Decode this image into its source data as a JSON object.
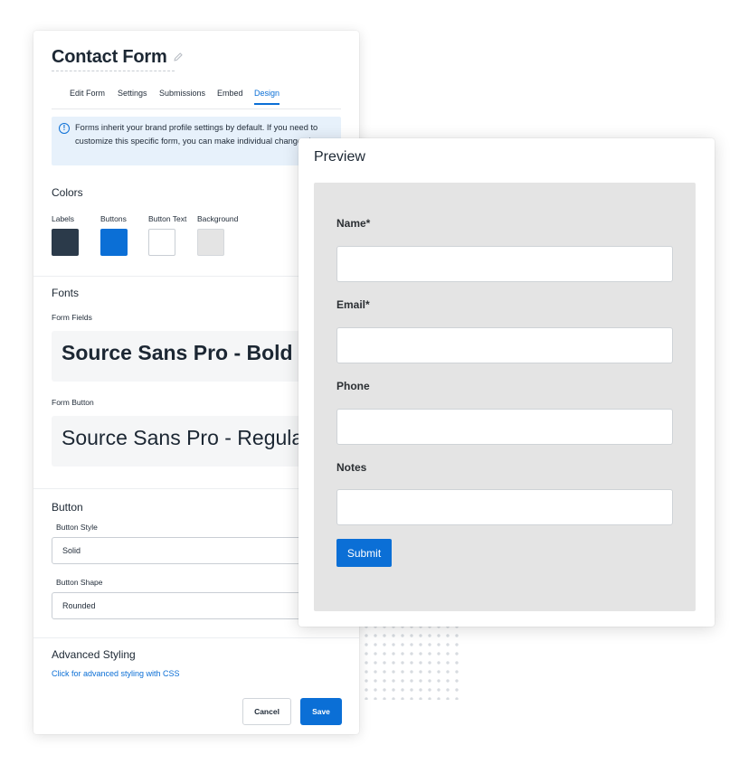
{
  "form": {
    "title": "Contact Form",
    "tabs": [
      {
        "label": "Edit Form",
        "active": false
      },
      {
        "label": "Settings",
        "active": false
      },
      {
        "label": "Submissions",
        "active": false
      },
      {
        "label": "Embed",
        "active": false
      },
      {
        "label": "Design",
        "active": true
      }
    ],
    "info_text": "Forms inherit your brand profile settings by default. If you need to customize this specific form, you can make individual changes here."
  },
  "colors": {
    "title": "Colors",
    "swatches": [
      {
        "label": "Labels",
        "color": "#2b3a4a"
      },
      {
        "label": "Buttons",
        "color": "#0b6fd6"
      },
      {
        "label": "Button Text",
        "color": "#ffffff"
      },
      {
        "label": "Background",
        "color": "#e4e4e4"
      }
    ]
  },
  "fonts": {
    "title": "Fonts",
    "form_fields_label": "Form Fields",
    "form_fields_value": "Source Sans Pro - Bold",
    "form_button_label": "Form Button",
    "form_button_value": "Source Sans Pro - Regular"
  },
  "button": {
    "title": "Button",
    "style_label": "Button Style",
    "style_value": "Solid",
    "shape_label": "Button Shape",
    "shape_value": "Rounded"
  },
  "advanced": {
    "title": "Advanced Styling",
    "link": "Click for advanced styling with CSS"
  },
  "actions": {
    "cancel": "Cancel",
    "save": "Save"
  },
  "preview": {
    "title": "Preview",
    "fields": [
      {
        "label": "Name*"
      },
      {
        "label": "Email*"
      },
      {
        "label": "Phone"
      },
      {
        "label": "Notes"
      }
    ],
    "submit": "Submit"
  },
  "theme": {
    "accent": "#0b6fd6",
    "info_bg": "#e7f1fb",
    "preview_bg": "#e4e4e4"
  }
}
